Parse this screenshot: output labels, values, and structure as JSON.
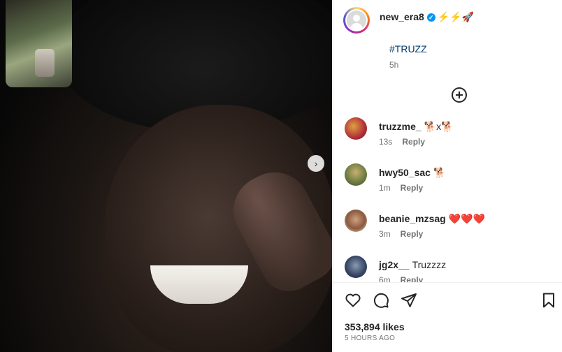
{
  "post": {
    "username": "new_era8",
    "verified_mark": "✓",
    "title_emojis": "⚡⚡🚀",
    "caption": "#TRUZZ",
    "time": "5h",
    "next_icon": "›"
  },
  "comments": [
    {
      "user": "truzzme_",
      "text": "🐕x🐕",
      "time": "13s",
      "reply": "Reply"
    },
    {
      "user": "hwy50_sac",
      "text": "🐕",
      "time": "1m",
      "reply": "Reply"
    },
    {
      "user": "beanie_mzsag",
      "text": "❤️❤️❤️",
      "time": "3m",
      "reply": "Reply"
    },
    {
      "user": "jg2x__",
      "text": "Truzzzz",
      "time": "6m",
      "reply": "Reply"
    }
  ],
  "footer": {
    "likes": "353,894 likes",
    "posted": "5 HOURS AGO"
  },
  "icons": [
    "heart-icon",
    "comment-icon",
    "share-icon",
    "bookmark-icon",
    "plus-circle-icon",
    "chevron-right-icon",
    "verified-icon"
  ]
}
